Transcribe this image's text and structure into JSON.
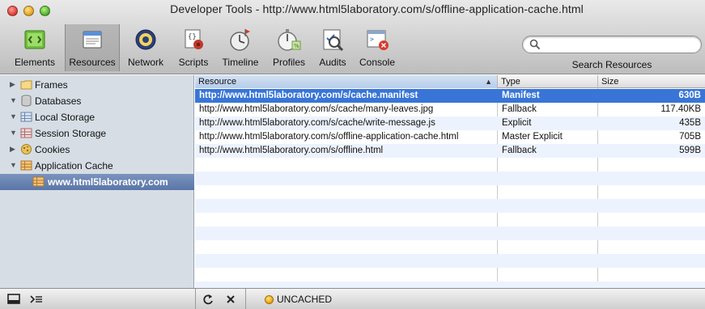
{
  "window": {
    "title": "Developer Tools - http://www.html5laboratory.com/s/offline-application-cache.html"
  },
  "toolbar": {
    "items": [
      {
        "label": "Elements",
        "icon": "elements-icon"
      },
      {
        "label": "Resources",
        "icon": "resources-icon",
        "selected": true
      },
      {
        "label": "Network",
        "icon": "network-icon"
      },
      {
        "label": "Scripts",
        "icon": "scripts-icon"
      },
      {
        "label": "Timeline",
        "icon": "timeline-icon"
      },
      {
        "label": "Profiles",
        "icon": "profiles-icon"
      },
      {
        "label": "Audits",
        "icon": "audits-icon"
      },
      {
        "label": "Console",
        "icon": "console-icon"
      }
    ],
    "search_label": "Search Resources",
    "search_value": ""
  },
  "sidebar": {
    "items": [
      {
        "label": "Frames",
        "icon": "folder-icon",
        "expanded": false
      },
      {
        "label": "Databases",
        "icon": "database-icon",
        "expanded": true
      },
      {
        "label": "Local Storage",
        "icon": "local-storage-icon",
        "expanded": true
      },
      {
        "label": "Session Storage",
        "icon": "session-storage-icon",
        "expanded": true
      },
      {
        "label": "Cookies",
        "icon": "cookie-icon",
        "expanded": false
      },
      {
        "label": "Application Cache",
        "icon": "application-cache-icon",
        "expanded": true
      },
      {
        "label": "www.html5laboratory.com",
        "icon": "application-cache-icon",
        "selected": true
      }
    ]
  },
  "table": {
    "columns": [
      "Resource",
      "Type",
      "Size"
    ],
    "sorted_column": "Resource",
    "sort_direction": "ascending",
    "rows": [
      {
        "resource": "http://www.html5laboratory.com/s/cache.manifest",
        "type": "Manifest",
        "size": "630B",
        "selected": true
      },
      {
        "resource": "http://www.html5laboratory.com/s/cache/many-leaves.jpg",
        "type": "Fallback",
        "size": "117.40KB"
      },
      {
        "resource": "http://www.html5laboratory.com/s/cache/write-message.js",
        "type": "Explicit",
        "size": "435B"
      },
      {
        "resource": "http://www.html5laboratory.com/s/offline-application-cache.html",
        "type": "Master Explicit",
        "size": "705B"
      },
      {
        "resource": "http://www.html5laboratory.com/s/offline.html",
        "type": "Fallback",
        "size": "599B"
      }
    ]
  },
  "statusbar": {
    "status_text": "UNCACHED",
    "status_color": "#f0a818",
    "buttons": [
      "dock-icon",
      "console-toggle-icon",
      "refresh-icon",
      "delete-icon"
    ]
  },
  "colors": {
    "selection": "#3875d7",
    "sidebar_bg": "#d6dde5",
    "sidebar_selected": "#5a76a9",
    "row_alt": "#edf3fe"
  }
}
